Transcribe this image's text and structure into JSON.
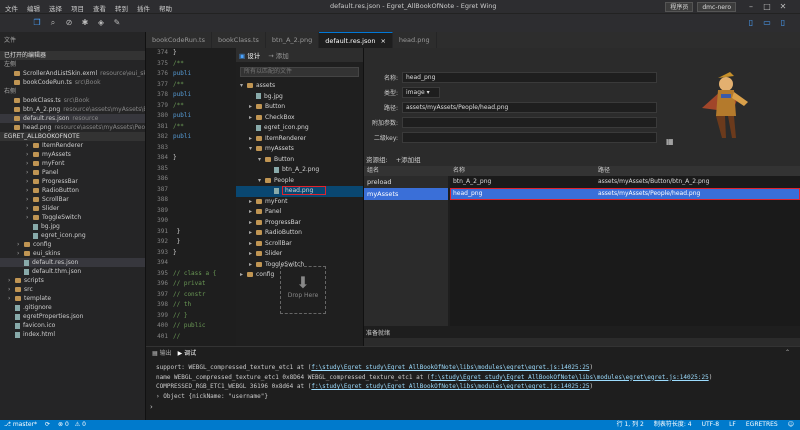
{
  "window": {
    "menu": [
      "文件",
      "编辑",
      "选择",
      "项目",
      "查看",
      "转到",
      "插件",
      "帮助"
    ],
    "title": "default.res.json - Egret_AllBookOfNote - Egret Wing",
    "mode": "程序员",
    "user": "dmc-nero"
  },
  "sidebar": {
    "header": "文件",
    "open_editors": "已打开的编辑器",
    "group1": "左侧",
    "group1_items": [
      {
        "name": "ScrollerAndListSkin.exml",
        "path": "resource\\eui_ski..."
      },
      {
        "name": "bookCodeRun.ts",
        "path": "src\\Book"
      }
    ],
    "group2": "右侧",
    "group2_items": [
      {
        "name": "bookClass.ts",
        "path": "src\\Book"
      },
      {
        "name": "btn_A_2.png",
        "path": "resource\\assets\\myAssets\\But..."
      },
      {
        "name": "default.res.json",
        "path": "resource"
      },
      {
        "name": "head.png",
        "path": "resource\\assets\\myAssets\\People"
      }
    ],
    "project": "EGRET_ALLBOOKOFNOTE",
    "tree": [
      {
        "label": "ItemRenderer",
        "indent": 2,
        "kind": "dir",
        "open": false
      },
      {
        "label": "myAssets",
        "indent": 2,
        "kind": "dir",
        "open": false
      },
      {
        "label": "myFont",
        "indent": 2,
        "kind": "dir",
        "open": false
      },
      {
        "label": "Panel",
        "indent": 2,
        "kind": "dir",
        "open": false
      },
      {
        "label": "ProgressBar",
        "indent": 2,
        "kind": "dir",
        "open": false
      },
      {
        "label": "RadioButton",
        "indent": 2,
        "kind": "dir",
        "open": false
      },
      {
        "label": "ScrollBar",
        "indent": 2,
        "kind": "dir",
        "open": false
      },
      {
        "label": "Slider",
        "indent": 2,
        "kind": "dir",
        "open": false
      },
      {
        "label": "ToggleSwitch",
        "indent": 2,
        "kind": "dir",
        "open": false
      },
      {
        "label": "bg.jpg",
        "indent": 2,
        "kind": "file"
      },
      {
        "label": "egret_icon.png",
        "indent": 2,
        "kind": "file"
      },
      {
        "label": "config",
        "indent": 1,
        "kind": "dir",
        "open": false
      },
      {
        "label": "eui_skins",
        "indent": 1,
        "kind": "dir",
        "open": false
      },
      {
        "label": "default.res.json",
        "indent": 1,
        "kind": "file",
        "selected": true
      },
      {
        "label": "default.thm.json",
        "indent": 1,
        "kind": "file"
      },
      {
        "label": "scripts",
        "indent": 0,
        "kind": "dir",
        "open": false
      },
      {
        "label": "src",
        "indent": 0,
        "kind": "dir",
        "open": false
      },
      {
        "label": "template",
        "indent": 0,
        "kind": "dir",
        "open": false
      },
      {
        "label": ".gitignore",
        "indent": 0,
        "kind": "file"
      },
      {
        "label": "egretProperties.json",
        "indent": 0,
        "kind": "file"
      },
      {
        "label": "favicon.ico",
        "indent": 0,
        "kind": "file"
      },
      {
        "label": "index.html",
        "indent": 0,
        "kind": "file"
      }
    ]
  },
  "tabs": [
    {
      "label": "bookCodeRun.ts",
      "active": false
    },
    {
      "label": "bookClass.ts",
      "active": false
    },
    {
      "label": "btn_A_2.png",
      "active": false
    },
    {
      "label": "default.res.json",
      "active": true
    },
    {
      "label": "head.png",
      "active": false
    }
  ],
  "code": [
    {
      "n": "374",
      "t": "}"
    },
    {
      "n": "375",
      "t": "/** "
    },
    {
      "n": "376",
      "t": "publi"
    },
    {
      "n": "377",
      "t": "/** "
    },
    {
      "n": "378",
      "t": "publi"
    },
    {
      "n": "379",
      "t": "/** "
    },
    {
      "n": "380",
      "t": "publi"
    },
    {
      "n": "381",
      "t": "/** "
    },
    {
      "n": "382",
      "t": "publi"
    },
    {
      "n": "383",
      "t": ""
    },
    {
      "n": "384",
      "t": "}"
    },
    {
      "n": "385",
      "t": ""
    },
    {
      "n": "386",
      "t": ""
    },
    {
      "n": "387",
      "t": ""
    },
    {
      "n": "388",
      "t": ""
    },
    {
      "n": "389",
      "t": ""
    },
    {
      "n": "390",
      "t": ""
    },
    {
      "n": "391",
      "t": "    }"
    },
    {
      "n": "392",
      "t": "  }"
    },
    {
      "n": "393",
      "t": "}"
    },
    {
      "n": "394",
      "t": ""
    },
    {
      "n": "395",
      "t": "// class a {"
    },
    {
      "n": "396",
      "t": "//    privat"
    },
    {
      "n": "397",
      "t": "//    constr"
    },
    {
      "n": "398",
      "t": "//       th"
    },
    {
      "n": "399",
      "t": "//    }"
    },
    {
      "n": "400",
      "t": "//    public"
    },
    {
      "n": "401",
      "t": "//       "
    }
  ],
  "designer": {
    "tab_design": "设计",
    "tab_add": "添加",
    "search_placeholder": "所有以匹配的文件",
    "tree": [
      {
        "label": "assets",
        "depth": 0,
        "open": true
      },
      {
        "label": "bg.jpg",
        "depth": 1,
        "file": true
      },
      {
        "label": "Button",
        "depth": 1
      },
      {
        "label": "CheckBox",
        "depth": 1
      },
      {
        "label": "egret_icon.png",
        "depth": 1,
        "file": true
      },
      {
        "label": "ItemRenderer",
        "depth": 1
      },
      {
        "label": "myAssets",
        "depth": 1,
        "open": true
      },
      {
        "label": "Button",
        "depth": 2,
        "open": true
      },
      {
        "label": "btn_A_2.png",
        "depth": 3,
        "file": true
      },
      {
        "label": "People",
        "depth": 2,
        "open": true
      },
      {
        "label": "head.png",
        "depth": 3,
        "file": true,
        "selected": true
      },
      {
        "label": "myFont",
        "depth": 1
      },
      {
        "label": "Panel",
        "depth": 1
      },
      {
        "label": "ProgressBar",
        "depth": 1
      },
      {
        "label": "RadioButton",
        "depth": 1
      },
      {
        "label": "ScrollBar",
        "depth": 1
      },
      {
        "label": "Slider",
        "depth": 1
      },
      {
        "label": "ToggleSwitch",
        "depth": 1
      },
      {
        "label": "config",
        "depth": 0
      }
    ],
    "drop_label": "Drop Here",
    "props": {
      "name_label": "名称:",
      "name_value": "head_png",
      "type_label": "类型:",
      "type_value": "image",
      "path_label": "路径:",
      "path_value": "assets/myAssets/People/head.png",
      "extra_label": "附加参数:",
      "key_label": "二级key:"
    },
    "groups_label": "资源组:",
    "add_group": "添加组",
    "group_col": "组名",
    "col_name": "名称",
    "col_path": "路径",
    "groups": [
      {
        "name": "preload",
        "selected": false
      },
      {
        "name": "myAssets",
        "selected": true
      }
    ],
    "rows": [
      {
        "name": "btn_A_2_png",
        "path": "assets/myAssets/Button/btn_A_2.png",
        "selected": false
      },
      {
        "name": "head_png",
        "path": "assets/myAssets/People/head.png",
        "selected": true
      }
    ],
    "status": "准备就绪"
  },
  "console": {
    "lines": [
      {
        "text": "support: WEBGL_compressed_texture_etc1      at (",
        "link": "f:\\study\\Egret_study\\Egret_AllBookOfNote\\libs\\modules\\egret\\egret.js:14025:25",
        "end": ")"
      },
      {
        "text": "name WEBGL_compressed_texture_etc1 0x8D64 WEBGL_compressed_texture_etc1    at (",
        "link": "f:\\study\\Egret_study\\Egret_AllBookOfNote\\libs\\modules\\egret\\egret.js:14025:25",
        "end": ")"
      },
      {
        "text": "COMPRESSED_RGB_ETC1_WEBGL 36196 0x8d64      at (",
        "link": "f:\\study\\Egret_study\\Egret_AllBookOfNote\\libs\\modules\\egret\\egret.js:14025:25",
        "end": ")"
      },
      {
        "text": "› Object {nickName: \"username\"}",
        "link": "",
        "end": ""
      }
    ]
  },
  "statusbar": {
    "branch": "master*",
    "position": "行 1, 列 2",
    "indent": "制表符长度: 4",
    "encoding": "UTF-8",
    "eol": "LF",
    "lang": "EGRETRES"
  }
}
